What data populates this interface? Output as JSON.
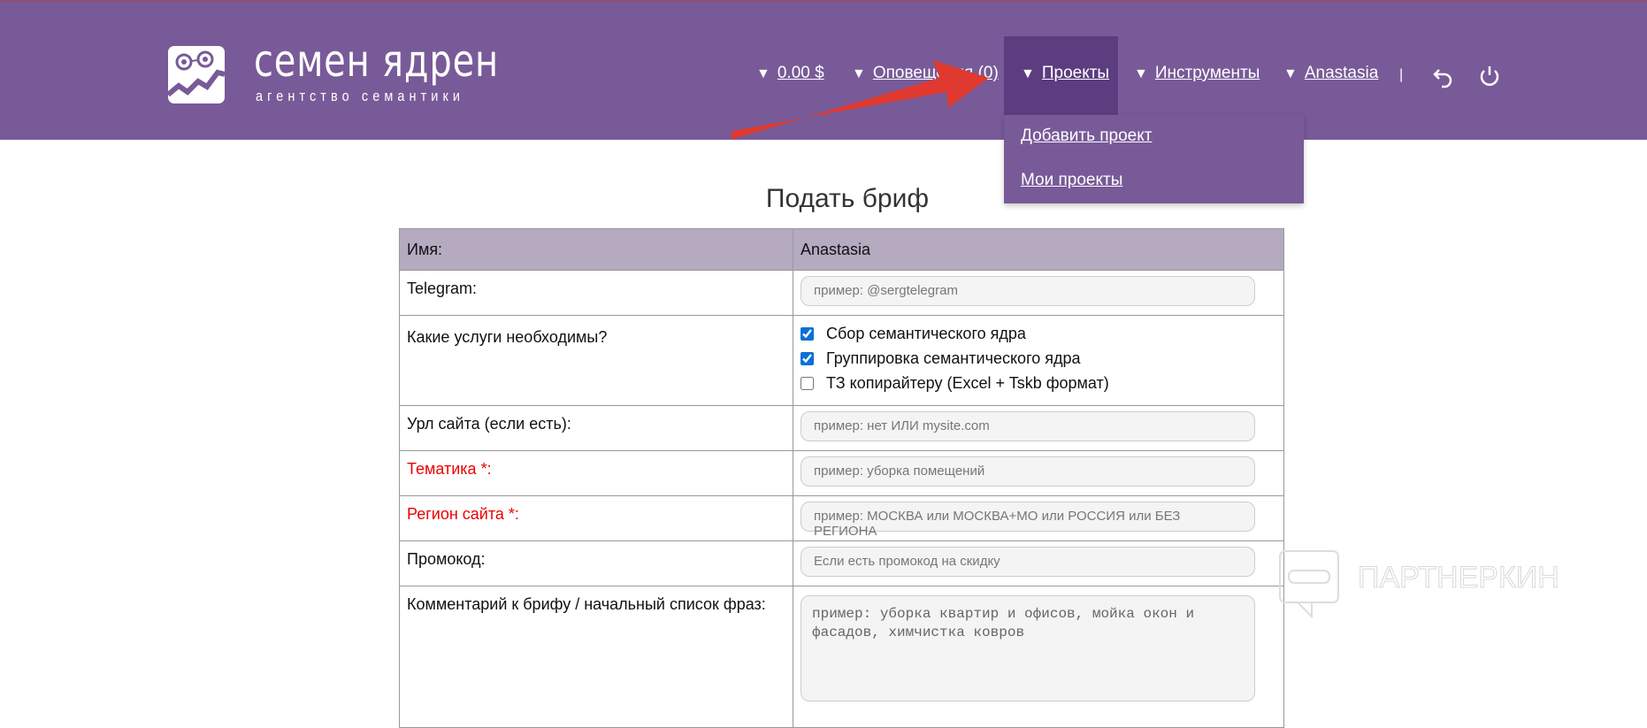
{
  "header": {
    "logo_title": "семен ядрен",
    "logo_subtitle": "агентство семантики",
    "nav": {
      "balance": "0.00 $",
      "notifications": "Оповещения (0)",
      "projects": "Проекты",
      "tools": "Инструменты",
      "user": "Anastasia",
      "separator": "|",
      "triangle": "▼"
    },
    "dropdown": {
      "add_project": "Добавить проект",
      "my_projects": "Мои проекты"
    }
  },
  "page_title": "Подать бриф",
  "form": {
    "name_label": "Имя:",
    "name_value": "Anastasia",
    "telegram_label": "Telegram:",
    "telegram_placeholder": "пример: @sergtelegram",
    "services_label": "Какие услуги необходимы?",
    "services": [
      {
        "label": "Сбор семантического ядра",
        "checked": true
      },
      {
        "label": "Группировка семантического ядра",
        "checked": true
      },
      {
        "label": "ТЗ копирайтеру (Excel + Tskb формат)",
        "checked": false
      }
    ],
    "url_label": "Урл сайта (если есть):",
    "url_placeholder": "пример: нет ИЛИ mysite.com",
    "topic_label": "Тематика *:",
    "topic_placeholder": "пример: уборка помещений",
    "region_label": "Регион сайта *:",
    "region_placeholder": "пример: МОСКВА или МОСКВА+МО или РОССИЯ или БЕЗ РЕГИОНА",
    "promo_label": "Промокод:",
    "promo_placeholder": "Если есть промокод на скидку",
    "comment_label": "Комментарий к брифу / начальный список фраз:",
    "comment_placeholder": "пример: уборка квартир и офисов, мойка окон и фасадов, химчистка ковров"
  },
  "watermark": "ПАРТНЕРКИН",
  "colors": {
    "header": "#785a98",
    "active": "#5c3d7f",
    "table_head": "#b5aac0",
    "required": "#ee0000",
    "arrow": "#e0392f"
  }
}
